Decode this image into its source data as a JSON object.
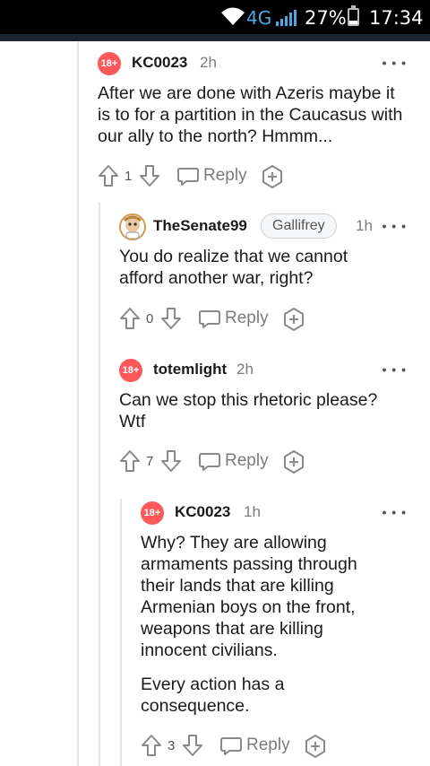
{
  "status_bar": {
    "network": "4G",
    "battery_percent": "27%",
    "battery_level": 0.27,
    "time": "17:34"
  },
  "comments": [
    {
      "avatar_badge": "18+",
      "username": "KC0023",
      "timestamp": "2h",
      "flair": "",
      "body": [
        "After we are done with Azeris maybe it is to for a partition in the Caucasus with our ally to the north? Hmmm..."
      ],
      "votes": "1",
      "reply_label": "Reply"
    },
    {
      "avatar_badge": "",
      "username": "TheSenate99",
      "timestamp": "1h",
      "flair": "Gallifrey",
      "body": [
        "You do realize that we cannot afford another war, right?"
      ],
      "votes": "0",
      "reply_label": "Reply"
    },
    {
      "avatar_badge": "18+",
      "username": "totemlight",
      "timestamp": "2h",
      "flair": "",
      "body": [
        "Can we stop this rhetoric please? Wtf"
      ],
      "votes": "7",
      "reply_label": "Reply"
    },
    {
      "avatar_badge": "18+",
      "username": "KC0023",
      "timestamp": "1h",
      "flair": "",
      "body": [
        "Why? They are allowing armaments passing through their lands that are killing Armenian boys on the front, weapons that are killing innocent civilians.",
        "Every action has a consequence."
      ],
      "votes": "3",
      "reply_label": "Reply"
    }
  ]
}
